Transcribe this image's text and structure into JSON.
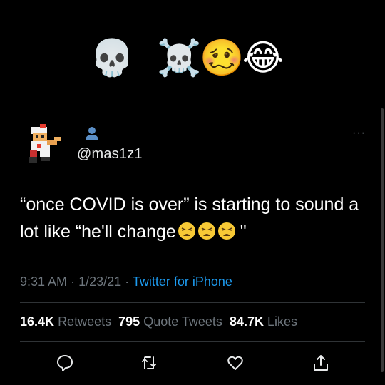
{
  "header_emojis": [
    "💀",
    "☠️",
    "🥴",
    "😂"
  ],
  "tweet": {
    "handle": "@mas1z1",
    "text_main": "“once COVID is over” is starting to sound a lot like “he'll change",
    "text_end": "\"",
    "emoji_count": 3,
    "time": "9:31 AM",
    "date": "1/23/21",
    "separator": "·",
    "source": "Twitter for iPhone",
    "more_label": "···"
  },
  "stats": {
    "retweets_count": "16.4K",
    "retweets_label": "Retweets",
    "quotes_count": "795",
    "quotes_label": "Quote Tweets",
    "likes_count": "84.7K",
    "likes_label": "Likes"
  },
  "actions": [
    "reply-icon",
    "retweet-icon",
    "like-icon",
    "share-icon"
  ],
  "colors": {
    "background": "#000000",
    "secondary": "#6e767d",
    "link": "#1d9bf0",
    "divider": "#2f3336"
  }
}
